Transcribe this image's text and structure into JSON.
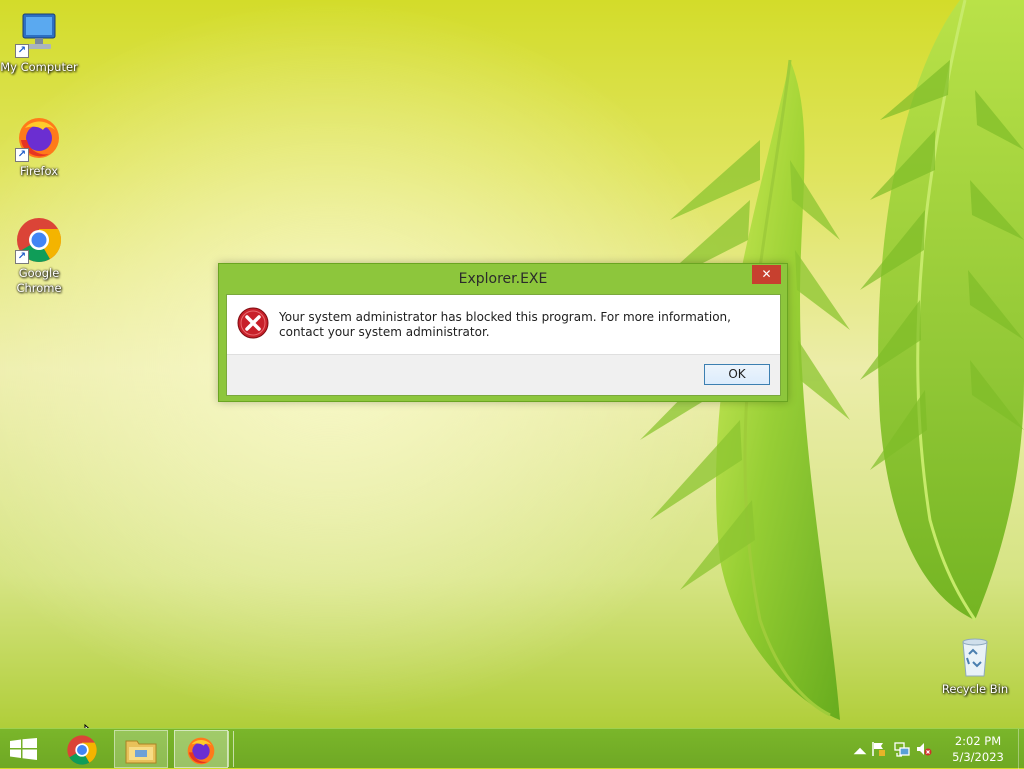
{
  "desktop": {
    "icons": [
      {
        "label": "My Computer"
      },
      {
        "label": "Firefox"
      },
      {
        "label": "Google Chrome"
      },
      {
        "label": "Recycle Bin"
      }
    ]
  },
  "dialog": {
    "title": "Explorer.EXE",
    "close_glyph": "✕",
    "message": "Your system administrator has blocked this program. For more information, contact your system administrator.",
    "ok_label": "OK",
    "icon": "error-icon"
  },
  "taskbar": {
    "pinned": [
      "windows-logo-icon",
      "chrome-icon",
      "file-explorer-icon",
      "firefox-icon"
    ],
    "tray": {
      "icons": [
        "chevron-up-icon",
        "action-center-flag-icon",
        "network-icon",
        "volume-muted-icon"
      ],
      "time": "2:02 PM",
      "date": "5/3/2023"
    }
  },
  "colors": {
    "taskbar": "#72ad26",
    "dialog_frame": "#8dc63c",
    "close_button": "#c7402f"
  }
}
